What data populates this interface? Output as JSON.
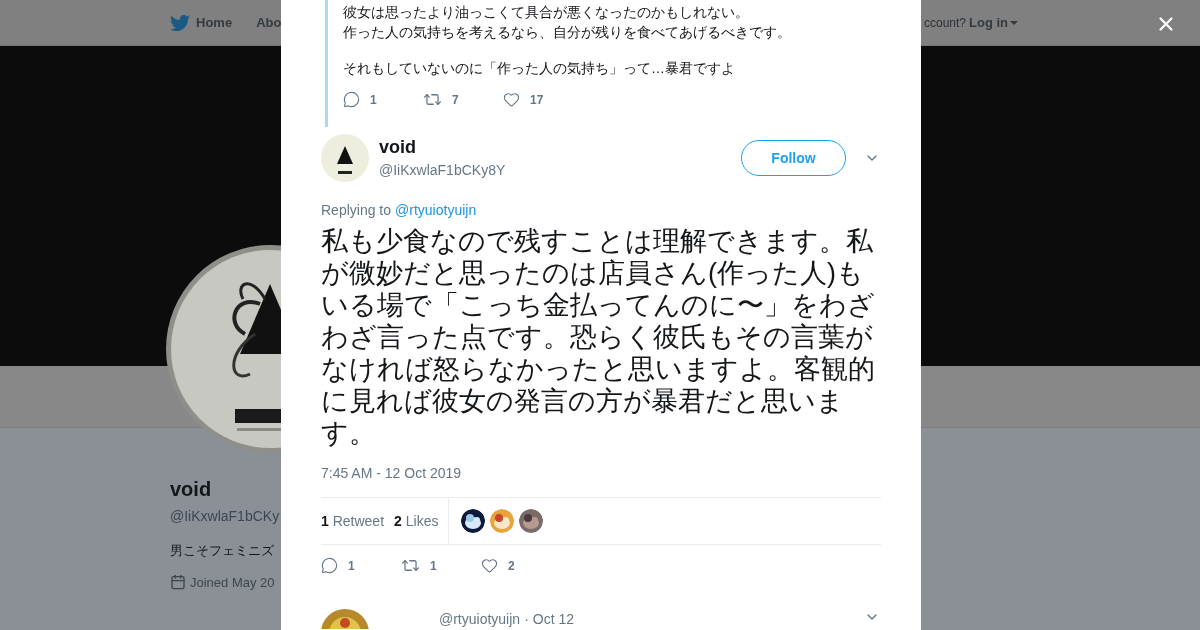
{
  "top_nav": {
    "items": [
      {
        "label": "Home",
        "kind": "home"
      },
      {
        "label": "Abo",
        "kind": "link"
      }
    ],
    "account_prompt": "ccount?",
    "login": "Log in"
  },
  "profile": {
    "name": "void",
    "handle": "@IiKxwlaF1bCKy",
    "bio": "男こそフェミニズ",
    "joined": "Joined May 20"
  },
  "parent_tweet": {
    "paragraphs": [
      [
        "彼女は思ったより油っこくて具合が悪くなったのかもしれない。",
        "作った人の気持ちを考えるなら、自分が残りを食べてあげるべきです。"
      ],
      [
        "それもしていないのに「作った人の気持ち」って…暴君ですよ"
      ]
    ],
    "actions": [
      {
        "kind": "reply",
        "count": "1"
      },
      {
        "kind": "retweet",
        "count": "7"
      },
      {
        "kind": "like",
        "count": "17"
      }
    ]
  },
  "tweet": {
    "name": "void",
    "handle": "@IiKxwlaF1bCKy8Y",
    "follow": "Follow",
    "replying_prefix": "Replying to",
    "replying_to": "@rtyuiotyuijn",
    "text": "私も少食なので残すことは理解できます。私が微妙だと思ったのは店員さん(作った人)もいる場で「こっち金払ってんのに〜」をわざわざ言った点です。恐らく彼氏もその言葉がなければ怒らなかったと思いますよ。客観的に見れば彼女の発言の方が暴君だと思います。",
    "timestamp": "7:45 AM - 12 Oct 2019",
    "stats": [
      {
        "count": "1",
        "label": "Retweet"
      },
      {
        "count": "2",
        "label": "Likes"
      }
    ],
    "actions": [
      {
        "kind": "reply",
        "count": "1"
      },
      {
        "kind": "retweet",
        "count": "1"
      },
      {
        "kind": "like",
        "count": "2"
      }
    ]
  },
  "next_tweet": {
    "handle": "@rtyuiotyuijn",
    "separator": "·",
    "date": "Oct 12"
  }
}
